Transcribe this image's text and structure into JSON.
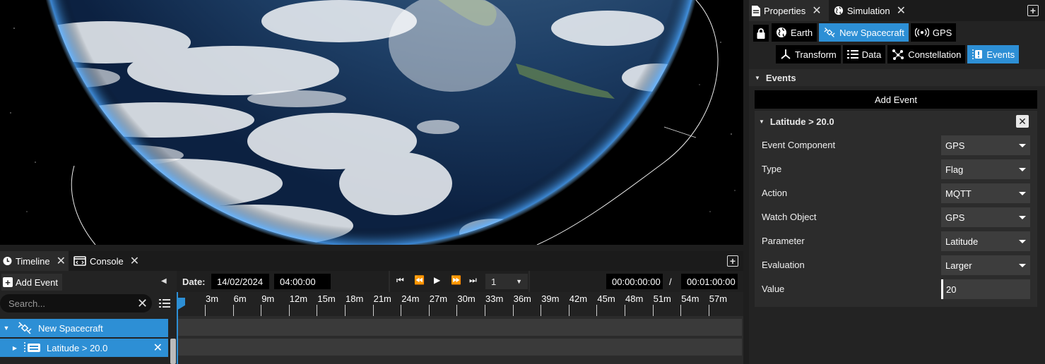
{
  "timeline_panel": {
    "tabs": [
      {
        "label": "Timeline",
        "icon": "clock-icon"
      },
      {
        "label": "Console",
        "icon": "console-icon"
      }
    ],
    "add_event_label": "Add Event",
    "search_placeholder": "Search...",
    "tree": [
      {
        "label": "New Spacecraft",
        "icon": "satellite-icon"
      },
      {
        "label": "Latitude > 20.0",
        "icon": "event-icon"
      }
    ],
    "date_label": "Date:",
    "date_value": "14/02/2024",
    "time_value": "04:00:00",
    "speed_value": "1",
    "current_time": "00:00:00:00",
    "time_separator": "/",
    "total_time": "00:01:00:00",
    "ruler_labels": [
      "3m",
      "6m",
      "9m",
      "12m",
      "15m",
      "18m",
      "21m",
      "24m",
      "27m",
      "30m",
      "33m",
      "36m",
      "39m",
      "42m",
      "45m",
      "48m",
      "51m",
      "54m",
      "57m"
    ]
  },
  "properties_panel": {
    "tabs": [
      {
        "label": "Properties",
        "icon": "document-icon"
      },
      {
        "label": "Simulation",
        "icon": "globe-icon"
      }
    ],
    "components": [
      {
        "label": "Earth",
        "icon": "globe-icon",
        "selected": false
      },
      {
        "label": "New Spacecraft",
        "icon": "satellite-icon",
        "selected": true
      },
      {
        "label": "GPS",
        "icon": "broadcast-icon",
        "selected": false
      }
    ],
    "sub_tabs": [
      {
        "label": "Transform",
        "icon": "axes-icon",
        "selected": false
      },
      {
        "label": "Data",
        "icon": "list-icon",
        "selected": false
      },
      {
        "label": "Constellation",
        "icon": "constellation-icon",
        "selected": false
      },
      {
        "label": "Events",
        "icon": "events-icon",
        "selected": true
      }
    ],
    "section_title": "Events",
    "add_event_label": "Add Event",
    "event": {
      "title": "Latitude > 20.0",
      "fields": [
        {
          "label": "Event Component",
          "value": "GPS"
        },
        {
          "label": "Type",
          "value": "Flag"
        },
        {
          "label": "Action",
          "value": "MQTT"
        },
        {
          "label": "Watch Object",
          "value": "GPS"
        },
        {
          "label": "Parameter",
          "value": "Latitude"
        },
        {
          "label": "Evaluation",
          "value": "Larger"
        }
      ],
      "value_label": "Value",
      "value": "20"
    }
  },
  "colors": {
    "accent": "#2d8fd5",
    "panel": "#232323",
    "field": "#3d3d3d"
  }
}
